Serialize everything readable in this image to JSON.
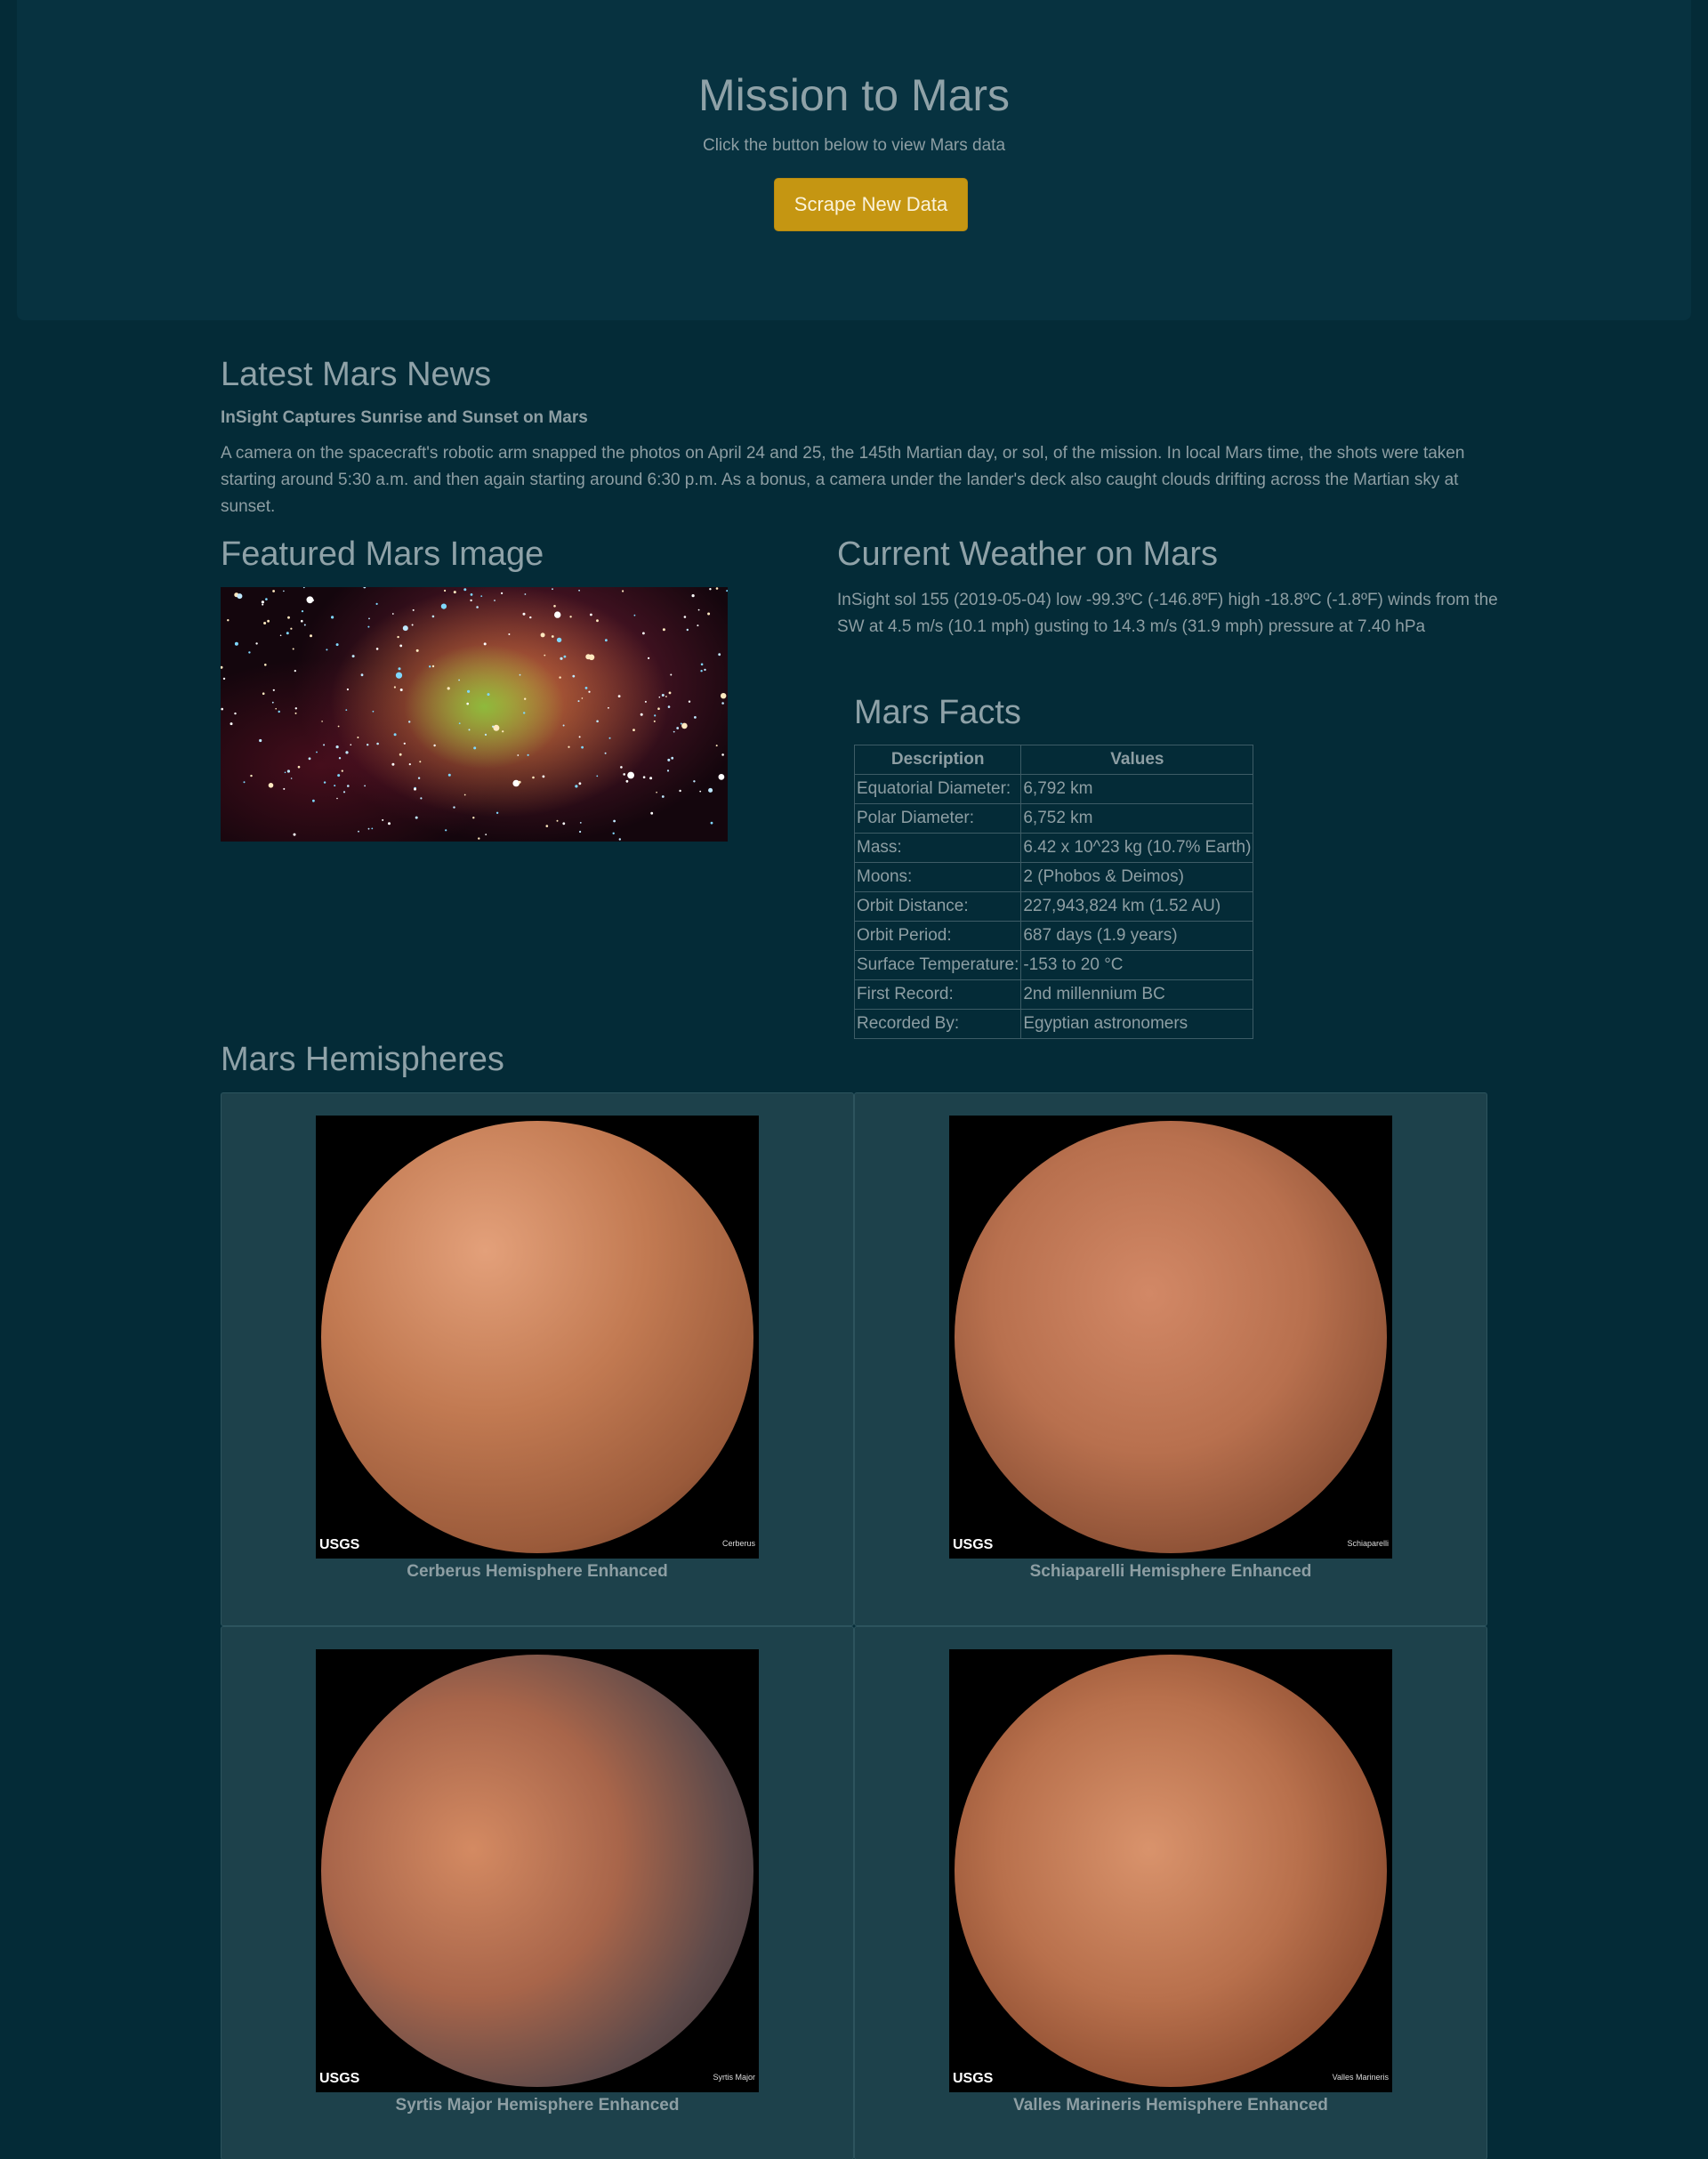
{
  "header": {
    "title": "Mission to Mars",
    "subtitle": "Click the button below to view Mars data",
    "button_label": "Scrape New Data"
  },
  "news": {
    "heading": "Latest Mars News",
    "title": "InSight Captures Sunrise and Sunset on Mars",
    "body": "A camera on the spacecraft's robotic arm snapped the photos on April 24 and 25, the 145th Martian day, or sol, of the mission. In local Mars time, the shots were taken starting around 5:30 a.m. and then again starting around 6:30 p.m. As a bonus, a camera under the lander's deck also caught clouds drifting across the Martian sky at sunset."
  },
  "featured": {
    "heading": "Featured Mars Image"
  },
  "weather": {
    "heading": "Current Weather on Mars",
    "text": "InSight sol 155 (2019-05-04) low -99.3ºC (-146.8ºF) high -18.8ºC (-1.8ºF) winds from the SW at 4.5 m/s (10.1 mph) gusting to 14.3 m/s (31.9 mph) pressure at 7.40 hPa"
  },
  "facts": {
    "heading": "Mars Facts",
    "columns": [
      "Description",
      "Values"
    ],
    "rows": [
      [
        "Equatorial Diameter:",
        "6,792 km"
      ],
      [
        "Polar Diameter:",
        "6,752 km"
      ],
      [
        "Mass:",
        "6.42 x 10^23 kg (10.7% Earth)"
      ],
      [
        "Moons:",
        "2 (Phobos & Deimos)"
      ],
      [
        "Orbit Distance:",
        "227,943,824 km (1.52 AU)"
      ],
      [
        "Orbit Period:",
        "687 days (1.9 years)"
      ],
      [
        "Surface Temperature:",
        "-153 to 20 °C"
      ],
      [
        "First Record:",
        "2nd millennium BC"
      ],
      [
        "Recorded By:",
        "Egyptian astronomers"
      ]
    ]
  },
  "hemispheres": {
    "heading": "Mars Hemispheres",
    "logo_text": "USGS",
    "items": [
      {
        "title": "Cerberus Hemisphere Enhanced",
        "label": "Cerberus"
      },
      {
        "title": "Schiaparelli Hemisphere Enhanced",
        "label": "Schiaparelli"
      },
      {
        "title": "Syrtis Major Hemisphere Enhanced",
        "label": "Syrtis Major"
      },
      {
        "title": "Valles Marineris Hemisphere Enhanced",
        "label": "Valles Marineris"
      }
    ]
  },
  "colors": {
    "background": "#042b37",
    "jumbotron": "#073240",
    "button": "#c59612",
    "card": "#1d414b"
  }
}
